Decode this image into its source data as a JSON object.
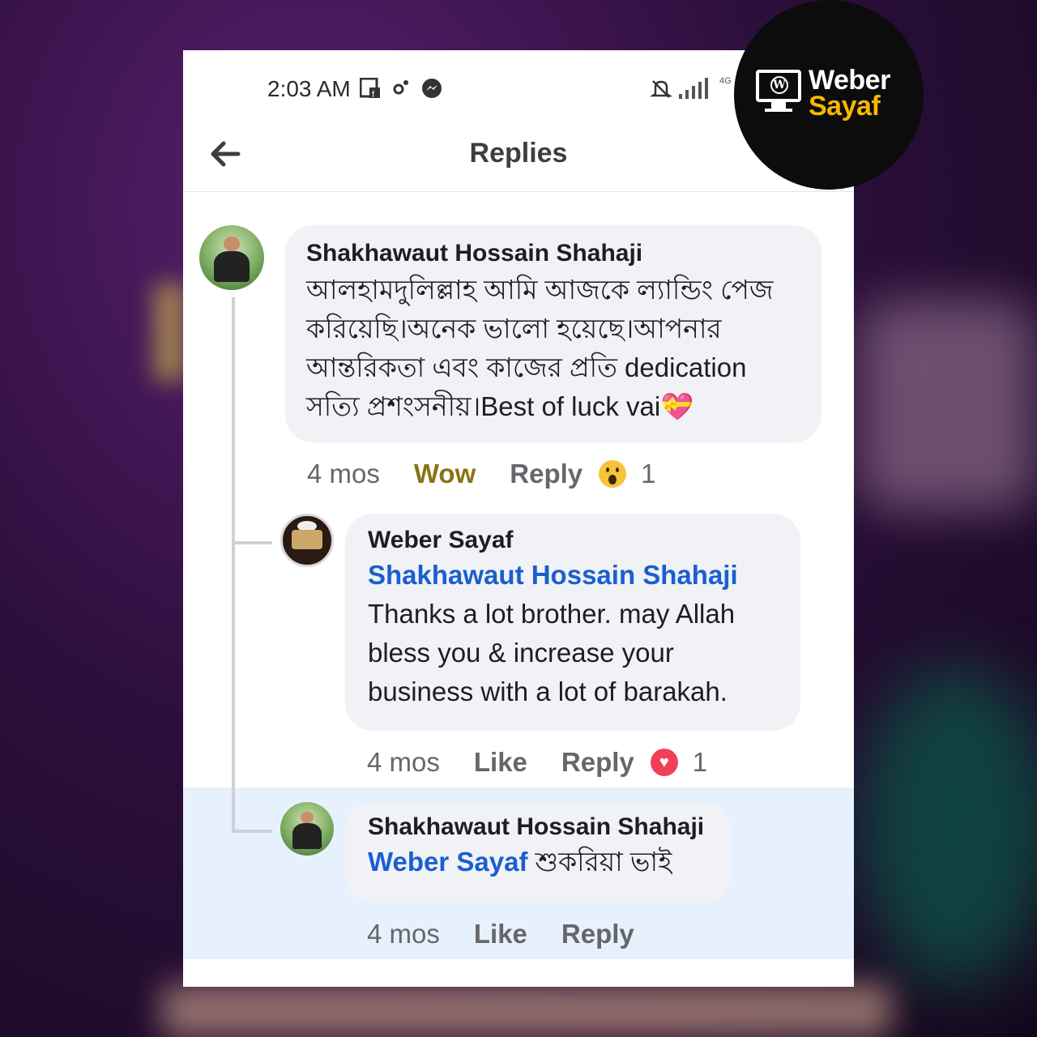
{
  "status_bar": {
    "time": "2:03 AM",
    "icons": [
      "facebook-page-icon",
      "gear-icon",
      "messenger-icon",
      "mute-icon",
      "signal-icon",
      "network-type-icon"
    ],
    "network": "4G"
  },
  "header": {
    "back_icon": "back-arrow-icon",
    "title": "Replies"
  },
  "comments": [
    {
      "author": "Shakhawaut Hossain Shahaji",
      "lines": [
        "আলহামদুলিল্লাহ আমি আজকে ল্যান্ডিং পেজ",
        "করিয়েছি।অনেক ভালো হয়েছে।আপনার",
        "আন্তরিকতা এবং কাজের প্রতি dedication",
        "সত্যি প্রশংসনীয়।Best of luck vai💝"
      ],
      "time": "4 mos",
      "action1": "Wow",
      "action2": "Reply",
      "reaction": "wow",
      "reaction_count": "1"
    },
    {
      "author": "Weber Sayaf",
      "mention": "Shakhawaut Hossain Shahaji",
      "lines": [
        "Thanks a lot brother. may Allah",
        "bless you & increase your",
        "business with a lot of barakah."
      ],
      "time": "4 mos",
      "action1": "Like",
      "action2": "Reply",
      "reaction": "love",
      "reaction_count": "1"
    },
    {
      "author": "Shakhawaut Hossain Shahaji",
      "mention": "Weber Sayaf",
      "text": "শুকরিয়া ভাই",
      "time": "4 mos",
      "action1": "Like",
      "action2": "Reply"
    }
  ],
  "watermark": {
    "line1": "Weber",
    "line2": "Sayaf",
    "accent": "#f5b800"
  }
}
